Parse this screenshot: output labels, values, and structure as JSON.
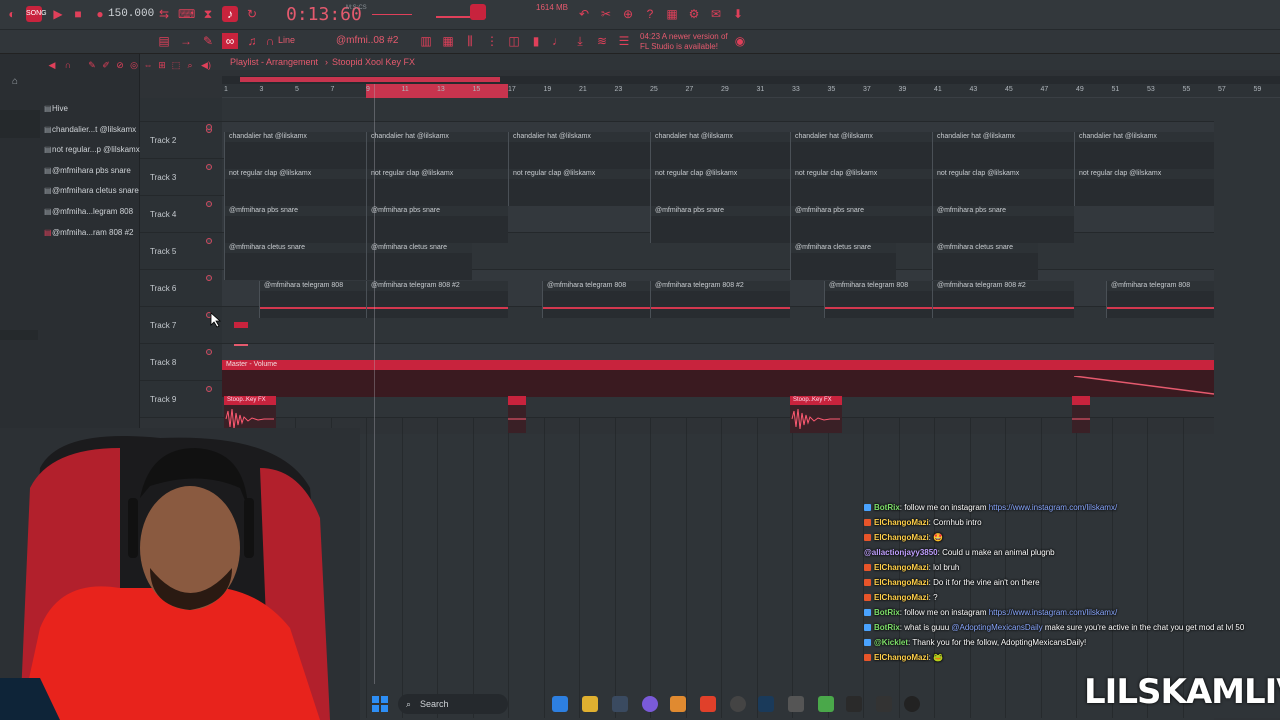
{
  "toolbar": {
    "tempo": "150.000",
    "time": "0:13:60",
    "time_label": "M:S:CS",
    "cpu": "1614 MB",
    "line_label": "Line",
    "pattern": "@mfmi..08 #2",
    "notice_line1": "04:23  A newer version of",
    "notice_line2": "FL Studio is available!"
  },
  "browser": {
    "items": [
      {
        "label": "Hive"
      },
      {
        "label": "chandalier...t @lilskamx"
      },
      {
        "label": "not regular...p @lilskamx"
      },
      {
        "label": "@mfmihara pbs snare"
      },
      {
        "label": "@mfmihara cletus snare"
      },
      {
        "label": "@mfmiha...legram 808"
      },
      {
        "label": "@mfmiha...ram 808 #2"
      }
    ]
  },
  "playlist": {
    "title": "Playlist - Arrangement",
    "separator": "›",
    "current_pattern": "Stoopid Xool Key FX",
    "ruler_ticks": [
      "1",
      "3",
      "5",
      "7",
      "9",
      "11",
      "13",
      "15",
      "17",
      "19",
      "21",
      "23",
      "25",
      "27",
      "29",
      "31",
      "33",
      "35",
      "37",
      "39",
      "41",
      "43",
      "45",
      "47",
      "49",
      "51",
      "53",
      "55",
      "57",
      "59"
    ],
    "tracks": [
      {
        "name": "Track 2",
        "clip_label": "chandalier hat @lilskamx"
      },
      {
        "name": "Track 3",
        "clip_label": "not regular clap @lilskamx"
      },
      {
        "name": "Track 4",
        "clip_label": "@mfmihara pbs snare"
      },
      {
        "name": "Track 5",
        "clip_label": "@mfmihara cletus snare"
      },
      {
        "name": "Track 6",
        "clip_label": "@mfmihara telegram 808",
        "clip_label_alt": "@mfmihara telegram 808 #2"
      },
      {
        "name": "Track 7"
      },
      {
        "name": "Track 8",
        "clip_label": "Master - Volume"
      },
      {
        "name": "Track 9",
        "clip_label": "Stoop..Key FX"
      }
    ]
  },
  "chat": {
    "messages": [
      {
        "user": "BotRix",
        "text": ": follow me on instagram ",
        "link": "https://www.instagram.com/lilskamx/",
        "badge_color": "#4aa3ff"
      },
      {
        "user": "ElChangoMazi",
        "text": ": Cornhub intro",
        "link": "",
        "badge_color": "#e8552a"
      },
      {
        "user": "ElChangoMazi",
        "text": ": 🤩",
        "link": "",
        "badge_color": "#e8552a"
      },
      {
        "user": "@allactionjayy3850",
        "text": ": Could u make an animal plugnb",
        "link": "",
        "badge_color": ""
      },
      {
        "user": "ElChangoMazi",
        "text": ": lol bruh",
        "link": "",
        "badge_color": "#e8552a"
      },
      {
        "user": "ElChangoMazi",
        "text": ": Do it for the vine ain't on there",
        "link": "",
        "badge_color": "#e8552a"
      },
      {
        "user": "ElChangoMazi",
        "text": ": ?",
        "link": "",
        "badge_color": "#e8552a"
      },
      {
        "user": "BotRix",
        "text": ": follow me on instagram ",
        "link": "https://www.instagram.com/lilskamx/",
        "badge_color": "#4aa3ff"
      },
      {
        "user": "BotRix",
        "text": ": what is guuu ",
        "mention": "@AdoptingMexicansDaily",
        "text2": " make sure you're active in the chat you get mod at lvl 50",
        "link": "",
        "badge_color": "#4aa3ff"
      },
      {
        "user": "@Kicklet",
        "text": ": Thank you for the follow, AdoptingMexicansDaily!",
        "link": "",
        "badge_color": "#4aa3ff"
      },
      {
        "user": "ElChangoMazi",
        "text": ": 🐸",
        "link": "",
        "badge_color": "#e8552a"
      }
    ]
  },
  "taskbar": {
    "search_label": "Search"
  },
  "watermark": "LILSKAMLIVE",
  "colors": {
    "accent": "#e0405a",
    "clip_red": "#c8233d",
    "background": "#2e3236"
  }
}
